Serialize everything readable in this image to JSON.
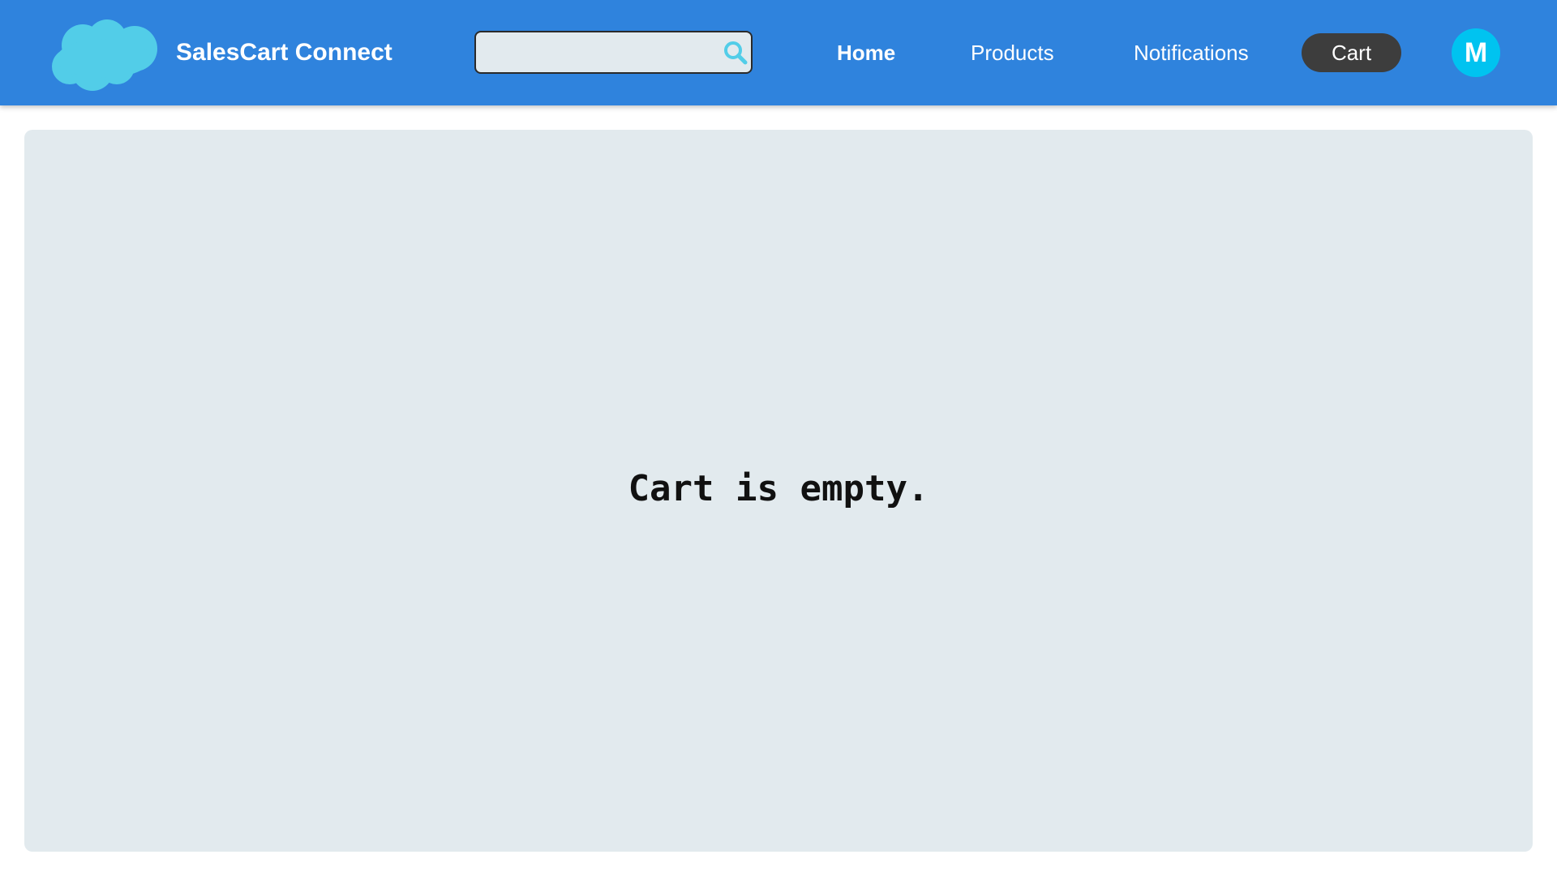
{
  "header": {
    "app_title": "SalesCart Connect",
    "logo_icon": "cloud-icon",
    "background_color": "#2f83dd"
  },
  "search": {
    "placeholder": "",
    "value": "",
    "icon": "search-icon"
  },
  "nav": {
    "home": "Home",
    "products": "Products",
    "notifications": "Notifications",
    "cart": "Cart",
    "active": "Cart"
  },
  "user": {
    "avatar_initial": "M",
    "avatar_color": "#00c3f0"
  },
  "main": {
    "empty_message": "Cart is empty."
  }
}
